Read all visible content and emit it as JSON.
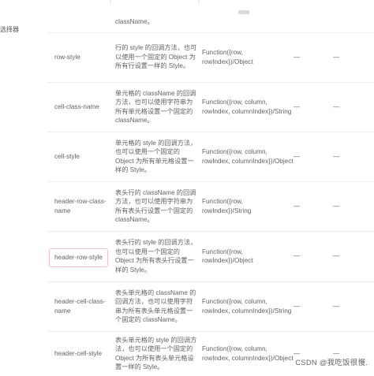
{
  "sidebar": {
    "label": "选择器"
  },
  "table": {
    "top_fragment": "className。",
    "rows": [
      {
        "name": "row-style",
        "description": "行的 style 的回调方法，也可以使用一个固定的 Object 为所有行设置一样的 Style。",
        "type": "Function({row, rowIndex})/Object",
        "options": "—",
        "default": "—"
      },
      {
        "name": "cell-class-name",
        "description": "单元格的 className 的回调方法，也可以使用字符串为所有单元格设置一个固定的 className。",
        "type": "Function({row, column, rowIndex, columnIndex})/String",
        "options": "—",
        "default": "—"
      },
      {
        "name": "cell-style",
        "description": "单元格的 style 的回调方法，也可以使用一个固定的 Object 为所有单元格设置一样的 Style。",
        "type": "Function({row, column, rowIndex, columnIndex})/Object",
        "options": "—",
        "default": "—"
      },
      {
        "name": "header-row-class-name",
        "description": "表头行的 className 的回调方法，也可以使用字符串为所有表头行设置一个固定的 className。",
        "type": "Function({row, rowIndex})/String",
        "options": "—",
        "default": "—"
      },
      {
        "name": "header-row-style",
        "description": "表头行的 style 的回调方法，也可以使用一个固定的 Object 为所有表头行设置一样的 Style。",
        "type": "Function({row, rowIndex})/Object",
        "options": "—",
        "default": "—"
      },
      {
        "name": "header-cell-class-name",
        "description": "表头单元格的 className 的回调方法，也可以使用字符串为所有表头单元格设置一个固定的 className。",
        "type": "Function({row, column, rowIndex, columnIndex})/String",
        "options": "—",
        "default": "—"
      },
      {
        "name": "header-cell-style",
        "description": "表头单元格的 style 的回调方法，也可以使用一个固定的 Object 为所有表头单元格设置一样的 Style。",
        "type": "Function({row, column, rowIndex, columnIndex})/Object",
        "options": "—",
        "default": "—"
      }
    ]
  },
  "watermark": "CSDN @我吃饭很慢."
}
